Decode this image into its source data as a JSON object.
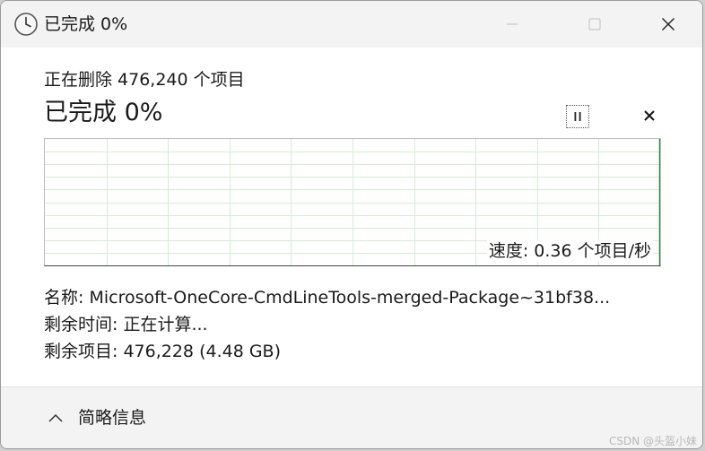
{
  "window": {
    "title": "已完成 0%"
  },
  "main": {
    "deleting_text": "正在删除 476,240 个项目",
    "percent_text": "已完成 0%",
    "speed_text": "速度: 0.36 个项目/秒",
    "progress_percent": 0
  },
  "details": {
    "name_label": "名称:",
    "name_value": "Microsoft-OneCore-CmdLineTools-merged-Package~31bf38...",
    "time_label": "剩余时间:",
    "time_value": "正在计算...",
    "items_label": "剩余项目:",
    "items_value": "476,228 (4.48 GB)"
  },
  "footer": {
    "toggle_label": "简略信息"
  },
  "watermark": "CSDN @头盔小妹",
  "colors": {
    "grid": "#d4ecd4",
    "graph_edge": "#2e8b3d"
  },
  "icons": {
    "app": "clock-icon",
    "minimize": "minimize-icon",
    "maximize": "maximize-icon",
    "close": "close-icon",
    "pause": "pause-icon",
    "stop": "stop-icon",
    "collapse": "chevron-up-icon"
  }
}
